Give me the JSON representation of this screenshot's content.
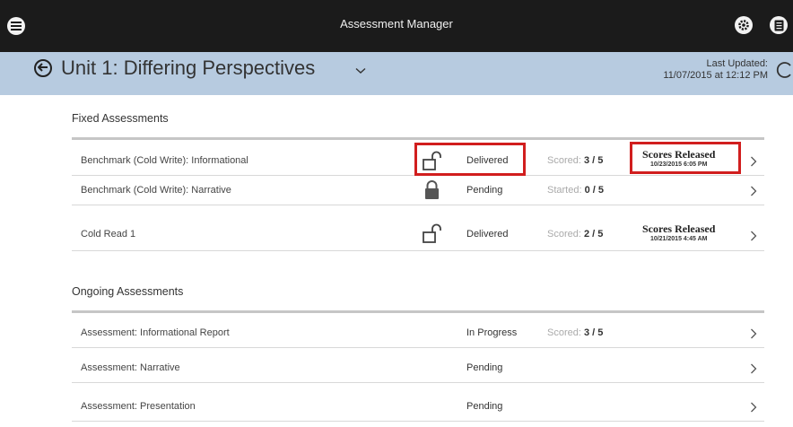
{
  "app": {
    "title": "Assessment Manager"
  },
  "header": {
    "unit_title": "Unit 1: Differing Perspectives",
    "last_updated_label": "Last Updated:",
    "last_updated_value": "11/07/2015 at 12:12 PM"
  },
  "fixed": {
    "label": "Fixed Assessments",
    "rows": [
      {
        "name": "Benchmark (Cold Write): Informational",
        "lock": "unlocked",
        "status": "Delivered",
        "score_label": "Scored:",
        "score_value": "3 / 5",
        "release_title": "Scores Released",
        "release_date": "10/23/2015 6:05 PM",
        "highlighted": true
      },
      {
        "name": "Benchmark (Cold Write): Narrative",
        "lock": "locked",
        "status": "Pending",
        "score_label": "Started:",
        "score_value": "0 / 5",
        "release_title": "",
        "release_date": ""
      },
      {
        "name": "Cold Read 1",
        "lock": "unlocked",
        "status": "Delivered",
        "score_label": "Scored:",
        "score_value": "2 / 5",
        "release_title": "Scores Released",
        "release_date": "10/21/2015 4:45 AM"
      }
    ]
  },
  "ongoing": {
    "label": "Ongoing Assessments",
    "rows": [
      {
        "name": "Assessment: Informational Report",
        "status": "In Progress",
        "score_label": "Scored:",
        "score_value": "3 / 5"
      },
      {
        "name": "Assessment: Narrative",
        "status": "Pending"
      },
      {
        "name": "Assessment: Presentation",
        "status": "Pending"
      }
    ]
  },
  "icons": {
    "menu": "menu-icon",
    "settings": "gear-icon",
    "book": "book-icon",
    "back": "back-arrow-icon",
    "dropdown": "chevron-down-icon",
    "refresh": "refresh-icon",
    "lock_open": "unlocked-padlock-icon",
    "lock_closed": "locked-padlock-icon",
    "row_arrow": "chevron-right-icon"
  },
  "colors": {
    "topbar": "#1b1b1b",
    "subheader": "#b7cbe0",
    "highlight": "#d11e1e"
  }
}
